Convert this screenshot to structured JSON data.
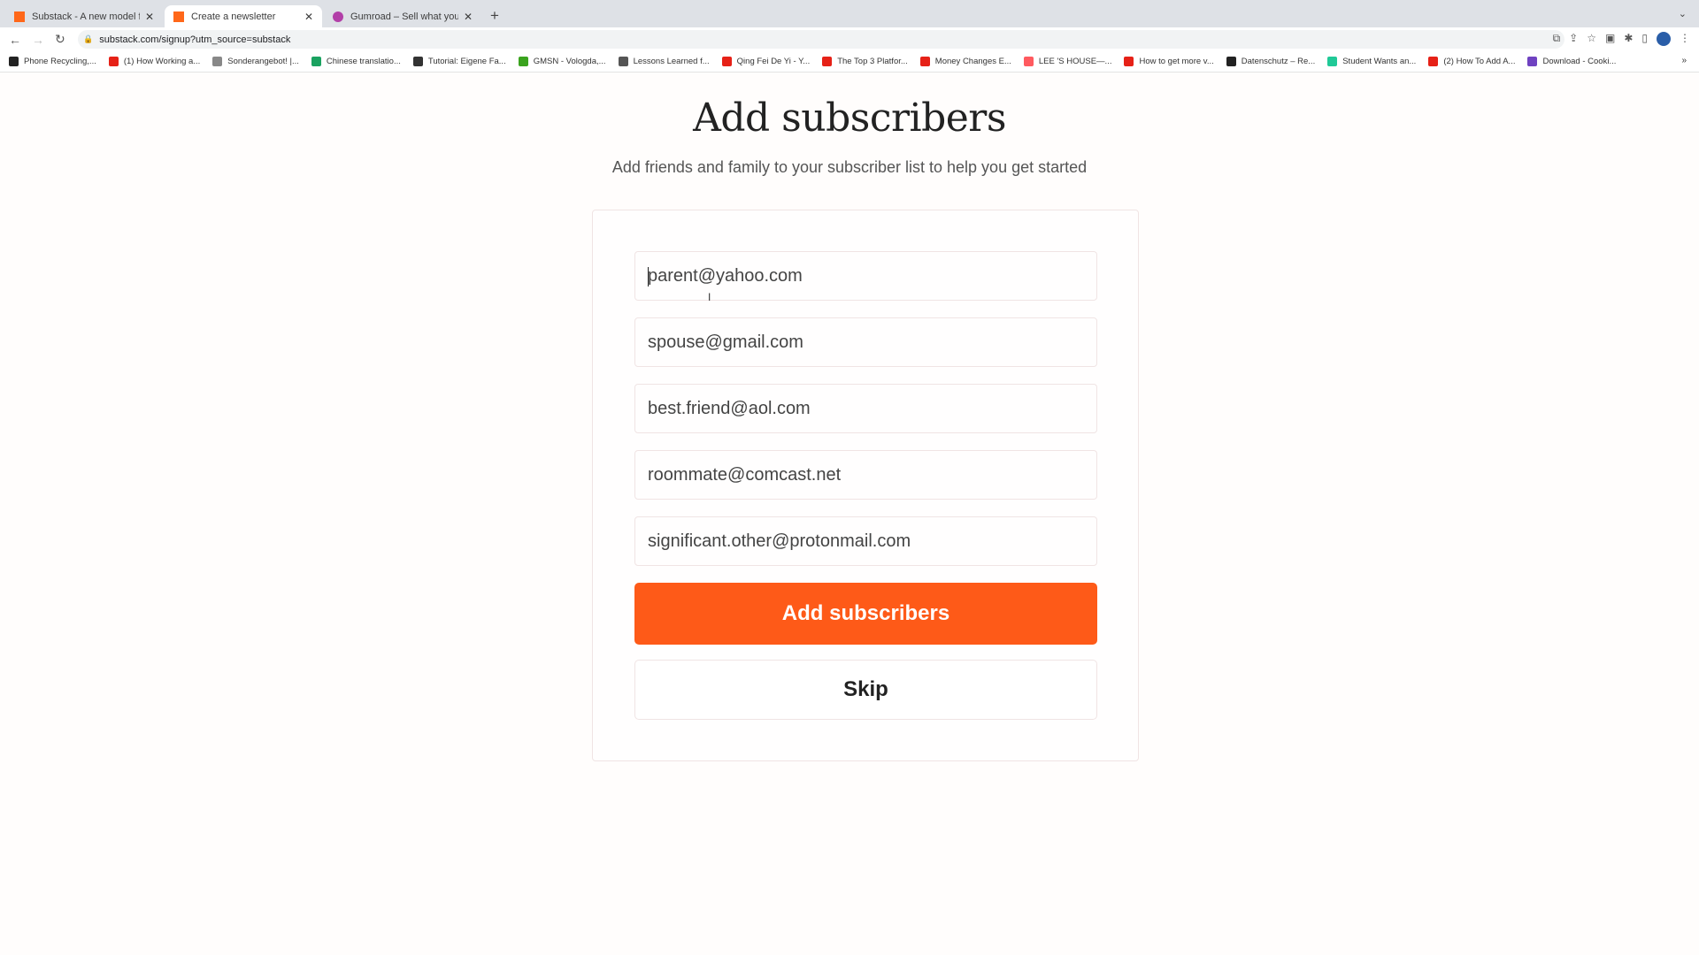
{
  "browser": {
    "tabs": [
      {
        "title": "Substack - A new model for pu",
        "icon": "substack-icon",
        "color": "#ff6719"
      },
      {
        "title": "Create a newsletter",
        "icon": "substack-icon",
        "color": "#ff6719",
        "active": true
      },
      {
        "title": "Gumroad – Sell what you know",
        "icon": "gumroad-icon",
        "color": "#b23fa8"
      }
    ],
    "new_tab": "+",
    "url": "substack.com/signup?utm_source=substack",
    "bookmarks": [
      {
        "label": "Phone Recycling,...",
        "color": "#222"
      },
      {
        "label": "(1) How Working a...",
        "color": "#e62117"
      },
      {
        "label": "Sonderangebot! |...",
        "color": "#888"
      },
      {
        "label": "Chinese translatio...",
        "color": "#1aa260"
      },
      {
        "label": "Tutorial: Eigene Fa...",
        "color": "#333"
      },
      {
        "label": "GMSN - Vologda,...",
        "color": "#3aa31e"
      },
      {
        "label": "Lessons Learned f...",
        "color": "#555"
      },
      {
        "label": "Qing Fei De Yi - Y...",
        "color": "#e62117"
      },
      {
        "label": "The Top 3 Platfor...",
        "color": "#e62117"
      },
      {
        "label": "Money Changes E...",
        "color": "#e62117"
      },
      {
        "label": "LEE 'S HOUSE—...",
        "color": "#ff5a5f"
      },
      {
        "label": "How to get more v...",
        "color": "#e62117"
      },
      {
        "label": "Datenschutz – Re...",
        "color": "#222"
      },
      {
        "label": "Student Wants an...",
        "color": "#20c997"
      },
      {
        "label": "(2) How To Add A...",
        "color": "#e62117"
      },
      {
        "label": "Download - Cooki...",
        "color": "#6f42c1"
      }
    ],
    "more": "»"
  },
  "page": {
    "title": "Add subscribers",
    "subtitle": "Add friends and family to your subscriber list to help you get started",
    "emails": [
      "parent@yahoo.com",
      "spouse@gmail.com",
      "best.friend@aol.com",
      "roommate@comcast.net",
      "significant.other@protonmail.com"
    ],
    "submit_label": "Add subscribers",
    "skip_label": "Skip",
    "accent": "#fe5a18"
  }
}
